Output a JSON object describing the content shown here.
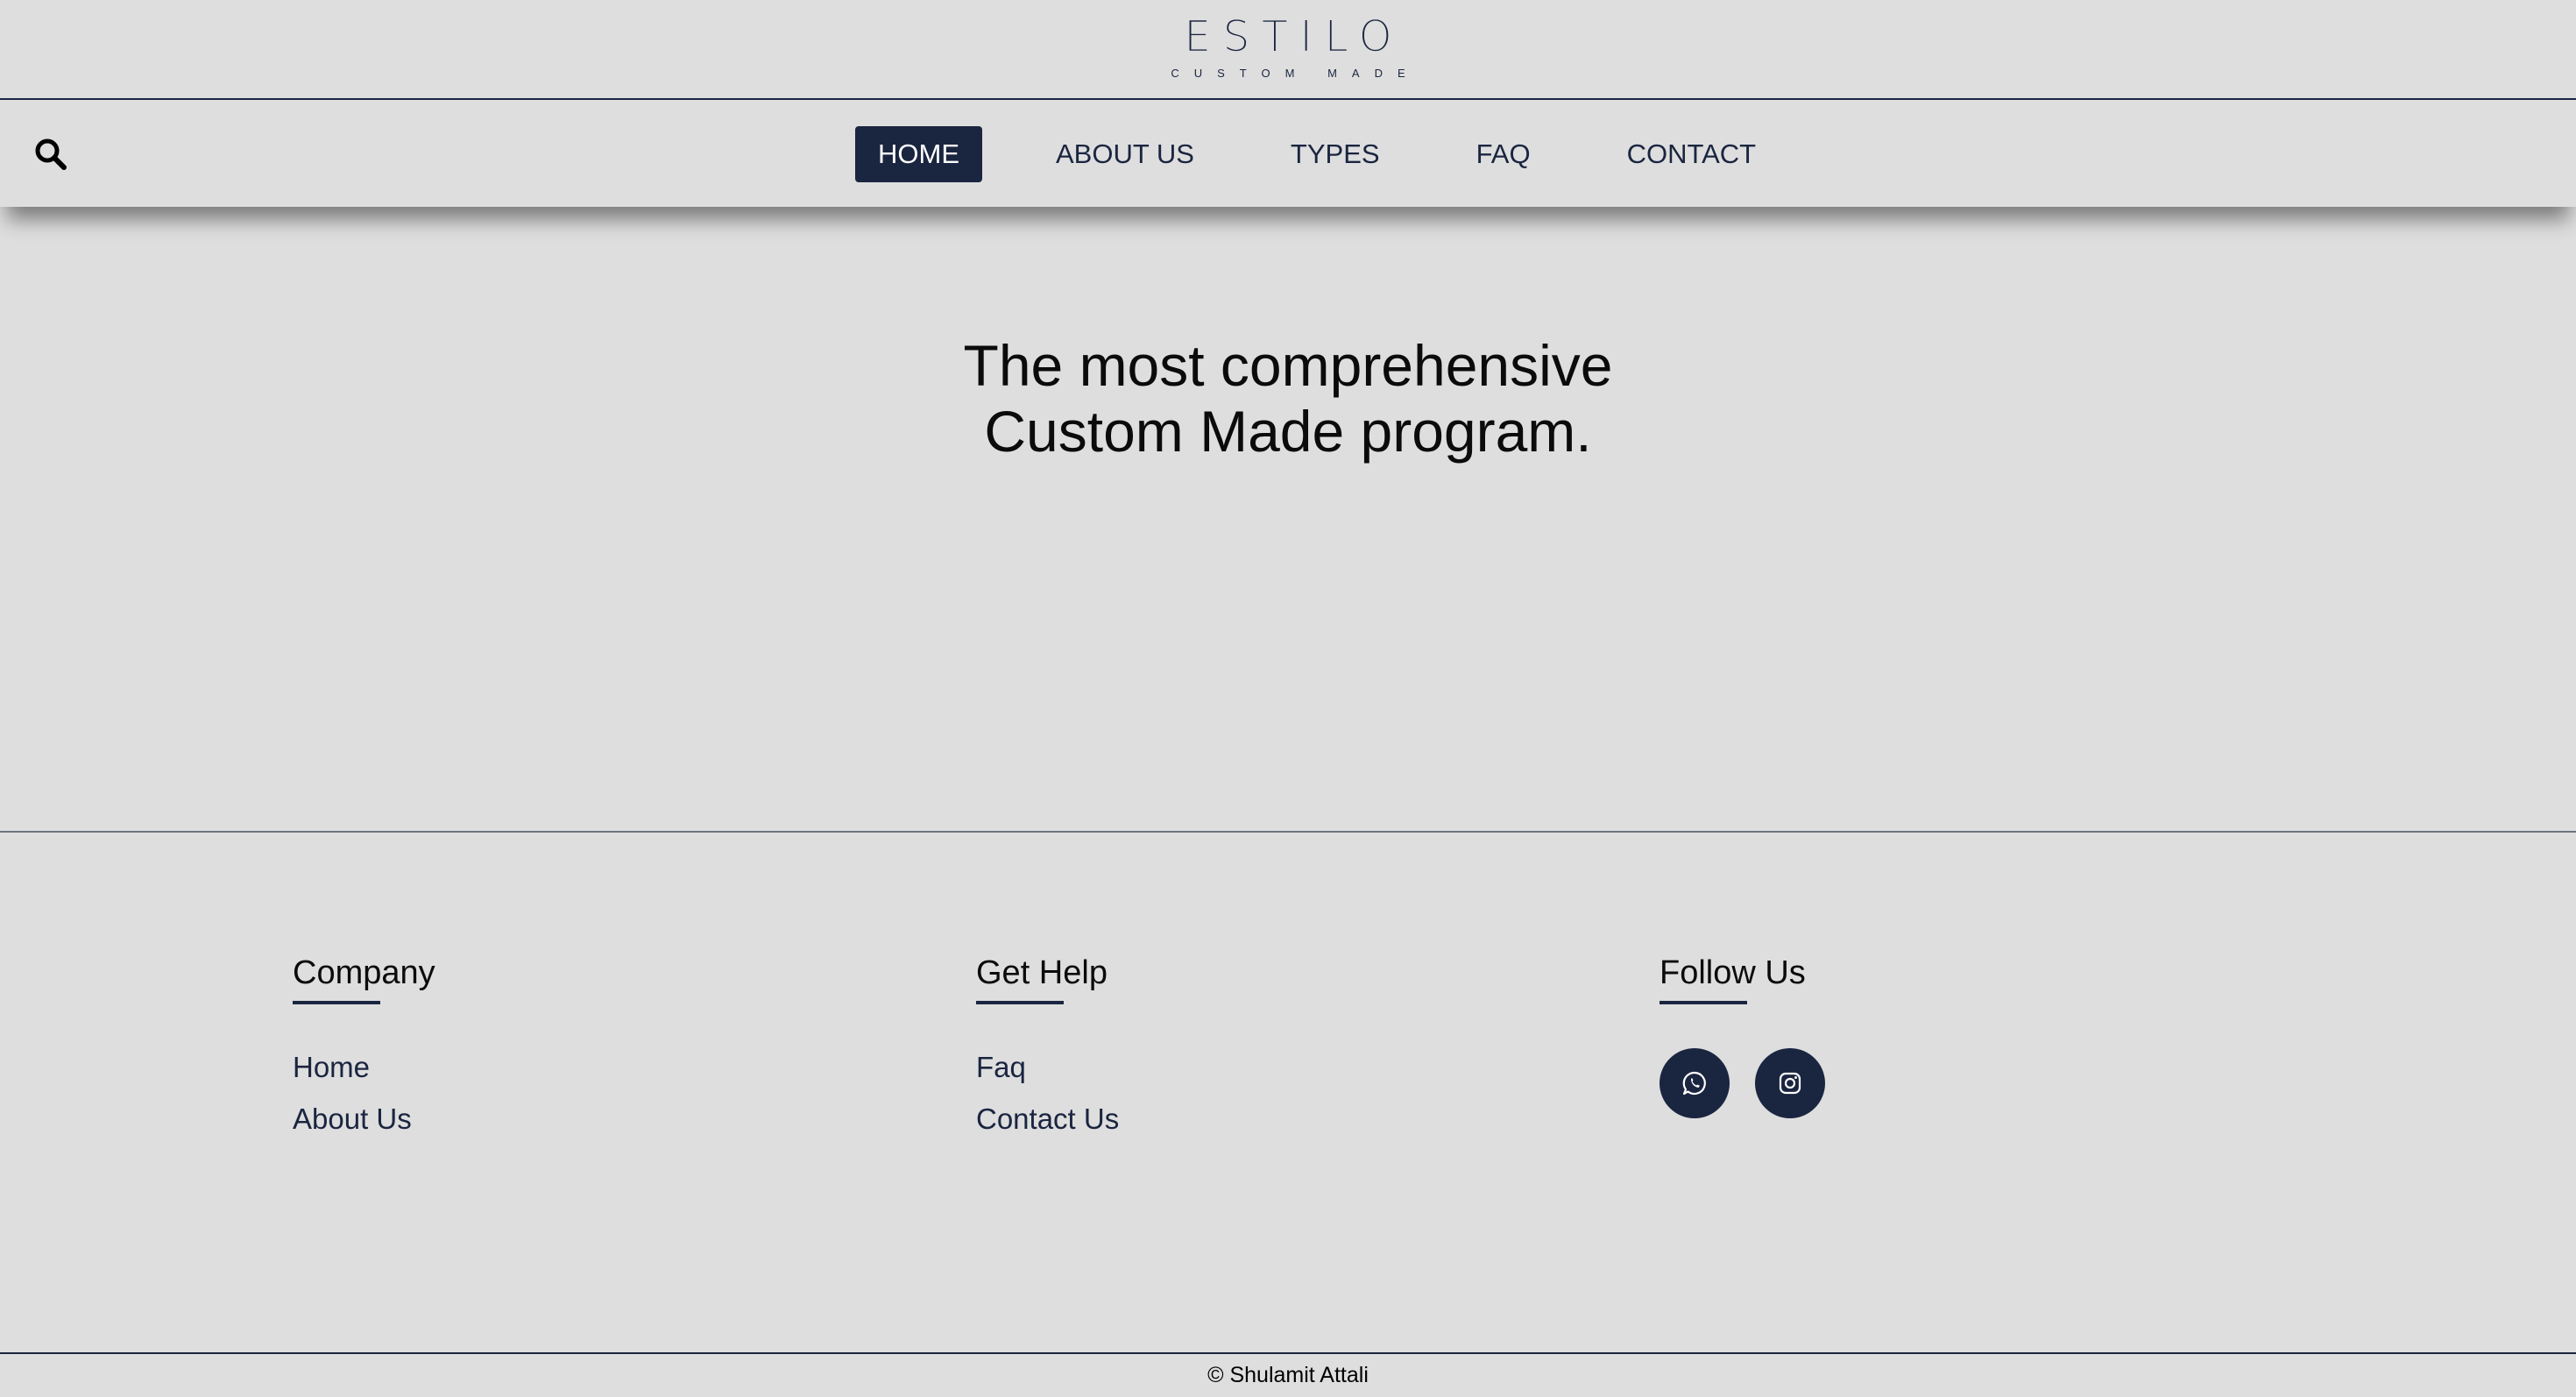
{
  "logo": {
    "word": "ESTILO",
    "tagline": "CUSTOM MADE"
  },
  "nav": {
    "items": [
      {
        "label": "HOME",
        "active": true
      },
      {
        "label": "ABOUT US",
        "active": false
      },
      {
        "label": "TYPES",
        "active": false
      },
      {
        "label": "FAQ",
        "active": false
      },
      {
        "label": "CONTACT",
        "active": false
      }
    ]
  },
  "hero": {
    "line1": "The most comprehensive",
    "line2": "Custom Made program."
  },
  "footer": {
    "company": {
      "heading": "Company",
      "links": [
        "Home",
        "About Us"
      ]
    },
    "help": {
      "heading": "Get Help",
      "links": [
        "Faq",
        "Contact Us"
      ]
    },
    "follow": {
      "heading": "Follow Us",
      "socials": [
        "whatsapp-icon",
        "instagram-icon"
      ]
    },
    "copyright": "© Shulamit Attali"
  },
  "colors": {
    "navy": "#1a2540",
    "background": "#dedede"
  }
}
